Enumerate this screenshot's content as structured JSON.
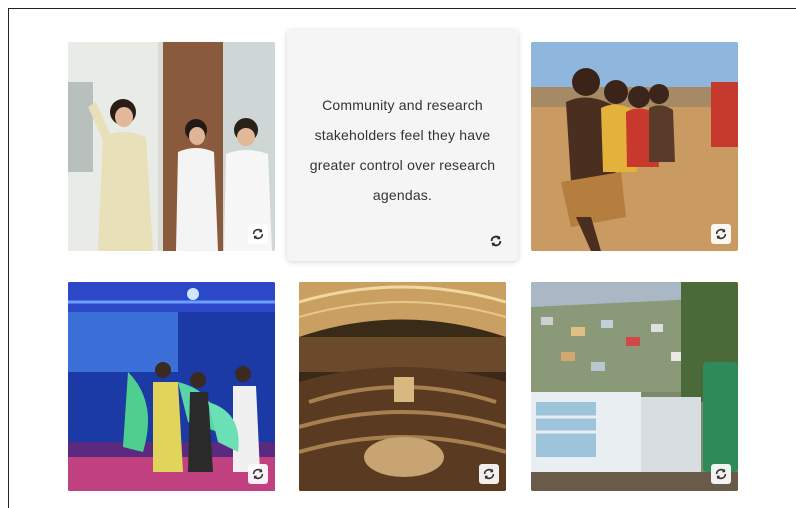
{
  "featured_card": {
    "text": "Community and research stakeholders feel they have greater control over research agendas.",
    "flip_icon": "flip-arrows-icon"
  },
  "cards": [
    {
      "subject": "scientist with children in lab coats",
      "flip_icon": "flip-arrows-icon"
    },
    {
      "subject": "smiling children sitting outdoors",
      "flip_icon": "flip-arrows-icon"
    },
    {
      "subject": "stage performance with dancers",
      "flip_icon": "flip-arrows-icon"
    },
    {
      "subject": "assembly hall",
      "flip_icon": "flip-arrows-icon"
    },
    {
      "subject": "hillside settlement houses",
      "flip_icon": "flip-arrows-icon"
    }
  ],
  "colors": {
    "text_card_bg": "#f5f5f5",
    "text_color": "#333333"
  }
}
